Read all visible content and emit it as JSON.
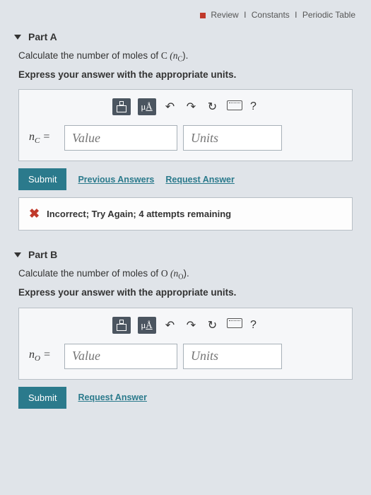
{
  "topnav": {
    "review": "Review",
    "constants": "Constants",
    "periodic": "Periodic Table",
    "sep": "I"
  },
  "partA": {
    "header": "Part A",
    "prompt_pre": "Calculate the number of moles of ",
    "prompt_elem": "C",
    "prompt_var_pre": " (n",
    "prompt_var_sub": "C",
    "prompt_post": ").",
    "express": "Express your answer with the appropriate units.",
    "var_pre": "n",
    "var_sub": "C",
    "eq": " =",
    "value_ph": "Value",
    "units_ph": "Units",
    "submit": "Submit",
    "prev": "Previous Answers",
    "req": "Request Answer",
    "feedback": "Incorrect; Try Again; 4 attempts remaining"
  },
  "partB": {
    "header": "Part B",
    "prompt_pre": "Calculate the number of moles of ",
    "prompt_elem": "O",
    "prompt_var_pre": " (n",
    "prompt_var_sub": "O",
    "prompt_post": ").",
    "express": "Express your answer with the appropriate units.",
    "var_pre": "n",
    "var_sub": "O",
    "eq": " =",
    "value_ph": "Value",
    "units_ph": "Units",
    "submit": "Submit",
    "req": "Request Answer"
  },
  "toolbar": {
    "mu": "μÅ",
    "undo": "↶",
    "redo": "↷",
    "reset": "↻",
    "help": "?"
  }
}
